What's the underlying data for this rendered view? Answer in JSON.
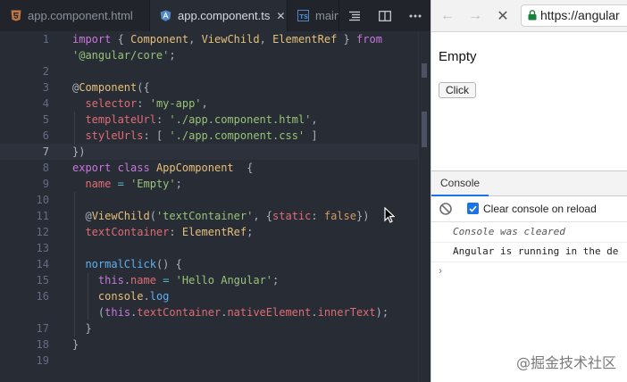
{
  "editor": {
    "tabs": [
      {
        "label": "app.component.html",
        "icon": "html5-file-icon",
        "active": false
      },
      {
        "label": "app.component.ts",
        "icon": "angular-file-icon",
        "active": true,
        "close": "✕"
      },
      {
        "label": "main",
        "icon": "typescript-file-icon",
        "active": false
      }
    ],
    "toolbar": [
      "outline-icon",
      "split-editor-icon",
      "more-icon"
    ],
    "line_numbers": [
      "1",
      "",
      "2",
      "3",
      "4",
      "5",
      "6",
      "7",
      "8",
      "9",
      "10",
      "11",
      "12",
      "13",
      "14",
      "15",
      "16",
      "",
      "17",
      "18",
      "19"
    ],
    "current_line": "7",
    "code": {
      "l1a": "import",
      "l1b": "{",
      "l1c": "Component",
      "l1d": ",",
      "l1e": "ViewChild",
      "l1f": ",",
      "l1g": "ElementRef",
      "l1h": "}",
      "l1i": "from",
      "l1w": "'@angular/core'",
      "l1w2": ";",
      "l3a": "@",
      "l3b": "Component",
      "l3c": "({",
      "l4a": "selector",
      "l4b": ":",
      "l4c": "'my-app'",
      "l4d": ",",
      "l5a": "templateUrl",
      "l5b": ":",
      "l5c": "'./app.component.html'",
      "l5d": ",",
      "l6a": "styleUrls",
      "l6b": ":",
      "l6c": "[",
      "l6d": "'./app.component.css'",
      "l6e": "]",
      "l7a": "})",
      "l8a": "export",
      "l8b": "class",
      "l8c": "AppComponent",
      "l8d": "{",
      "l9a": "name",
      "l9b": "=",
      "l9c": "'Empty'",
      "l9d": ";",
      "l11a": "@",
      "l11b": "ViewChild",
      "l11c": "(",
      "l11d": "'textContainer'",
      "l11e": ", {",
      "l11f": "static",
      "l11g": ":",
      "l11h": "false",
      "l11i": "})",
      "l12a": "textContainer",
      "l12b": ":",
      "l12c": "ElementRef",
      "l12d": ";",
      "l14a": "normalClick",
      "l14b": "() {",
      "l15a": "this",
      "l15b": ".",
      "l15c": "name",
      "l15d": "=",
      "l15e": "'Hello Angular'",
      "l15f": ";",
      "l16a": "console",
      "l16b": ".",
      "l16c": "log",
      "l16wa": "(",
      "l16wb": "this",
      "l16wc": ".",
      "l16wd": "textContainer",
      "l16we": ".",
      "l16wf": "nativeElement",
      "l16wg": ".",
      "l16wh": "innerText",
      "l16wi": ");",
      "l17a": "}",
      "l18a": "}"
    }
  },
  "browser": {
    "back": "←",
    "forward": "→",
    "stop": "✕",
    "url": "https://angular",
    "page_heading": "Empty",
    "button_label": "Click"
  },
  "devtools": {
    "tab_label": "Console",
    "clear_label": "Clear console on reload",
    "clear_checked": true,
    "messages": [
      "Console was cleared",
      "Angular is running in the de"
    ],
    "prompt": "›"
  },
  "watermark": "@掘金技术社区",
  "colors": {
    "editor_bg": "#282c34",
    "keyword": "#c678dd",
    "string": "#98c379",
    "class": "#e5c07b",
    "function": "#61afef",
    "property": "#e06c75",
    "accent": "#1a73e8"
  }
}
